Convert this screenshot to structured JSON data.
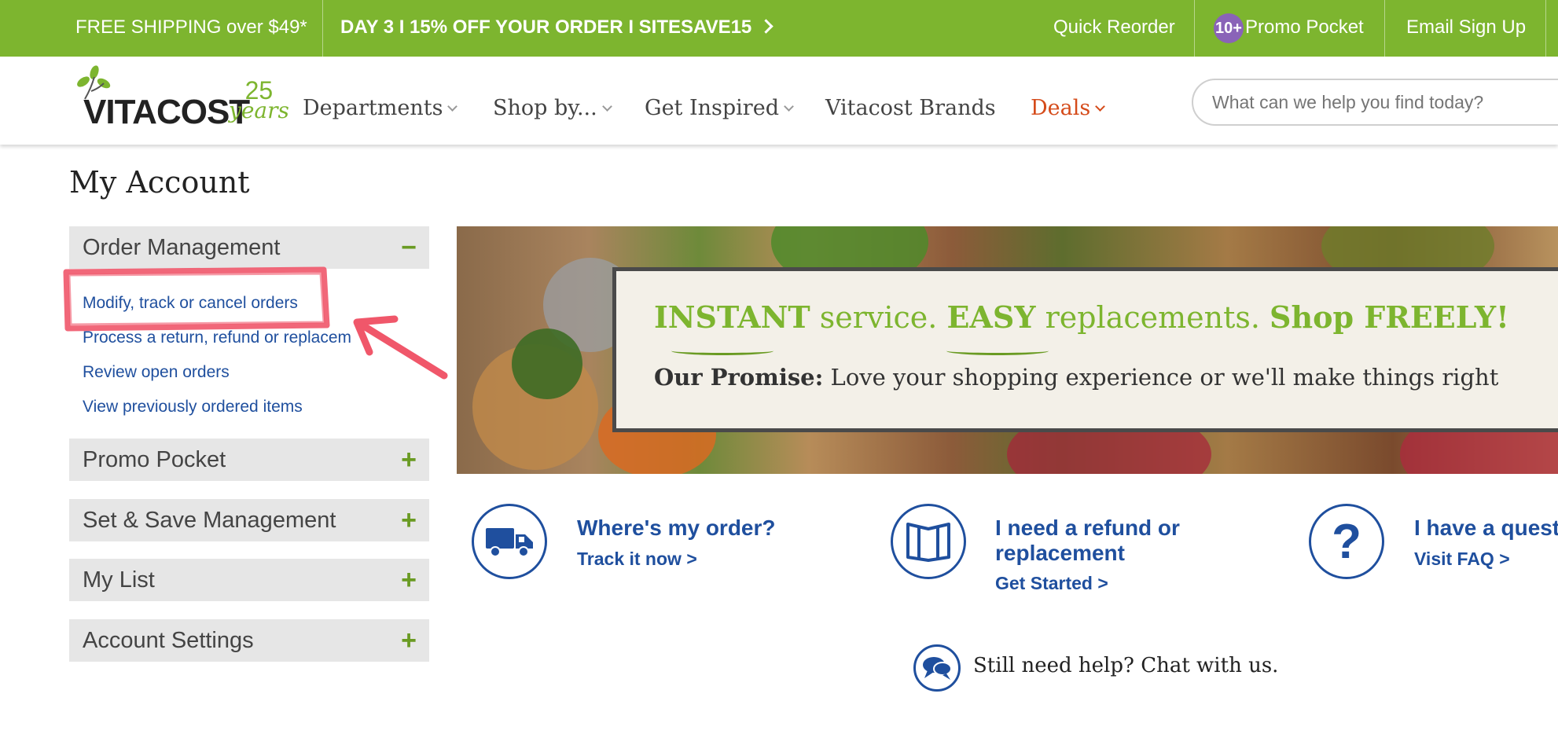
{
  "topbar": {
    "shipping": "FREE SHIPPING over $49*",
    "promo": "DAY 3 I 15% OFF YOUR ORDER I SITESAVE15",
    "quick_reorder": "Quick Reorder",
    "promo_pocket_badge": "10+",
    "promo_pocket": "Promo Pocket",
    "email_signup": "Email Sign Up"
  },
  "logo": {
    "word": "VITACOST",
    "years_number": "25",
    "years_word": "years"
  },
  "nav": {
    "departments": "Departments",
    "shop_by": "Shop by...",
    "get_inspired": "Get Inspired",
    "vitacost_brands": "Vitacost Brands",
    "deals": "Deals"
  },
  "search": {
    "placeholder": "What can we help you find today?"
  },
  "page": {
    "title": "My Account"
  },
  "sidebar": {
    "sections": [
      {
        "label": "Order Management",
        "toggle": "−"
      },
      {
        "label": "Promo Pocket",
        "toggle": "+"
      },
      {
        "label": "Set & Save Management",
        "toggle": "+"
      },
      {
        "label": "My List",
        "toggle": "+"
      },
      {
        "label": "Account Settings",
        "toggle": "+"
      }
    ],
    "order_links": [
      "Modify, track or cancel orders",
      "Process a return, refund or replacem",
      "Review open orders",
      "View previously ordered items"
    ]
  },
  "banner": {
    "h_instant": "INSTANT",
    "h_service": " service. ",
    "h_easy": "EASY",
    "h_replacements": " replacements. ",
    "h_shop_freely": "Shop FREELY!",
    "promise_label": "Our Promise:",
    "promise_text": " Love your shopping experience or we'll make things right"
  },
  "help": {
    "order_title": "Where's my order?",
    "order_link": "Track it now >",
    "refund_title_1": "I need a refund or",
    "refund_title_2": "replacement",
    "refund_link": "Get Started >",
    "question_title": "I have a quest",
    "question_link": "Visit FAQ >",
    "chat": "Still need help? Chat with us."
  },
  "colors": {
    "brand_green": "#7db52f",
    "link_blue": "#1f4f9e",
    "deals_orange": "#d54b1a",
    "badge_purple": "#8a63b8",
    "annotation_red": "#f0576a"
  }
}
